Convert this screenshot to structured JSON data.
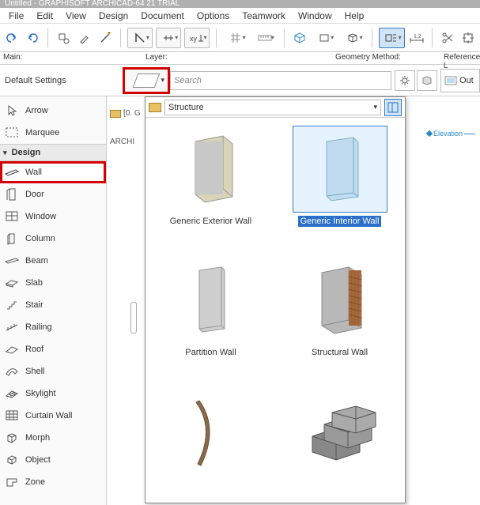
{
  "window": {
    "title": "Untitled - GRAPHISOFT ARCHICAD-64 21 TRIAL"
  },
  "menu": [
    "File",
    "Edit",
    "View",
    "Design",
    "Document",
    "Options",
    "Teamwork",
    "Window",
    "Help"
  ],
  "header2": {
    "main": "Main:",
    "layer": "Layer:",
    "geom": "Geometry Method:",
    "ref": "Reference L"
  },
  "row2": {
    "default": "Default Settings",
    "search_ph": "Search",
    "out": "Out"
  },
  "sidebar": {
    "top": [
      "Arrow",
      "Marquee"
    ],
    "group": "Design",
    "items": [
      "Wall",
      "Door",
      "Window",
      "Column",
      "Beam",
      "Slab",
      "Stair",
      "Railing",
      "Roof",
      "Shell",
      "Skylight",
      "Curtain Wall",
      "Morph",
      "Object",
      "Zone"
    ]
  },
  "canvas": {
    "tab": "[0. G",
    "archi": "ARCHI"
  },
  "flyout": {
    "structure": "Structure",
    "items": [
      {
        "label": "Generic Exterior Wall"
      },
      {
        "label": "Generic Interior Wall"
      },
      {
        "label": "Partition Wall"
      },
      {
        "label": "Structural Wall"
      },
      {
        "label": ""
      },
      {
        "label": ""
      }
    ]
  },
  "elev": "Elevation"
}
